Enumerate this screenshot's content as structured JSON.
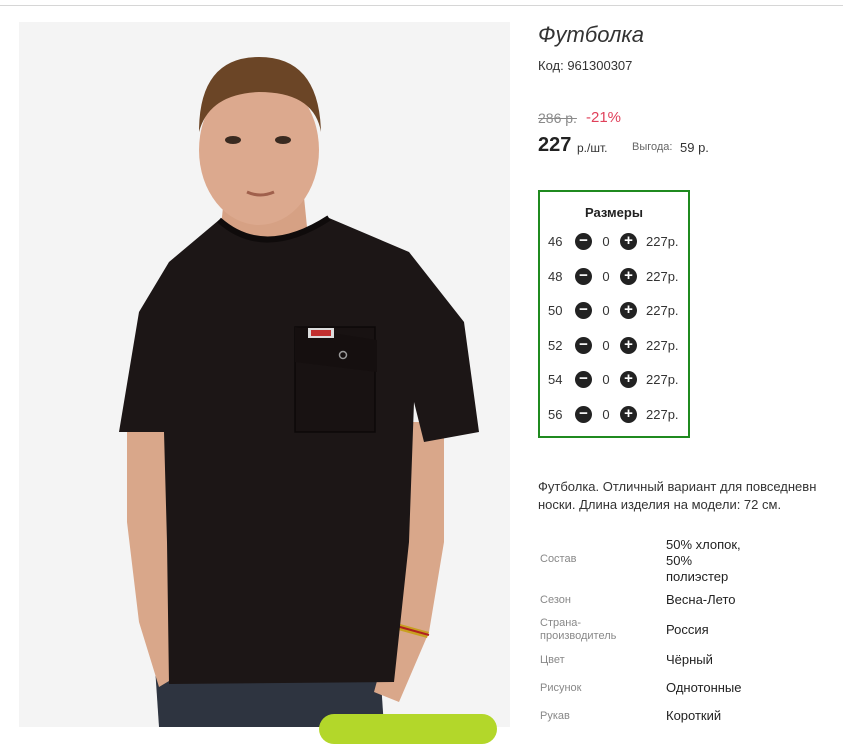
{
  "product": {
    "title": "Футболка",
    "code": "Код: 961300307",
    "old_price": "286 р.",
    "discount": "-21%",
    "price": "227",
    "unit": "р./шт.",
    "savings_label": "Выгода:",
    "savings_value": "59 р."
  },
  "sizes": {
    "title": "Размеры",
    "rows": [
      {
        "size": "46",
        "qty": "0",
        "price": "227р."
      },
      {
        "size": "48",
        "qty": "0",
        "price": "227р."
      },
      {
        "size": "50",
        "qty": "0",
        "price": "227р."
      },
      {
        "size": "52",
        "qty": "0",
        "price": "227р."
      },
      {
        "size": "54",
        "qty": "0",
        "price": "227р."
      },
      {
        "size": "56",
        "qty": "0",
        "price": "227р."
      }
    ],
    "minus_glyph": "−",
    "plus_glyph": "+"
  },
  "description": {
    "line1": "Футболка. Отличный вариант для повседневн",
    "line2": "носки. Длина изделия на модели: 72 см."
  },
  "attributes": [
    {
      "label": "Состав",
      "value_lines": [
        "50% хлопок,",
        "50%",
        "полиэстер"
      ]
    },
    {
      "label": "Сезон",
      "value_lines": [
        "Весна-Лето"
      ]
    },
    {
      "label_lines": [
        "Страна-",
        "производитель"
      ],
      "value_lines": [
        "Россия"
      ]
    },
    {
      "label": "Цвет",
      "value_lines": [
        "Чёрный"
      ]
    },
    {
      "label": "Рисунок",
      "value_lines": [
        "Однотонные"
      ]
    },
    {
      "label": "Рукав",
      "value_lines": [
        "Короткий"
      ]
    }
  ],
  "colors": {
    "sizes_border": "#1f8a1f",
    "discount": "#e0405a",
    "cta": "#b3d72a"
  }
}
